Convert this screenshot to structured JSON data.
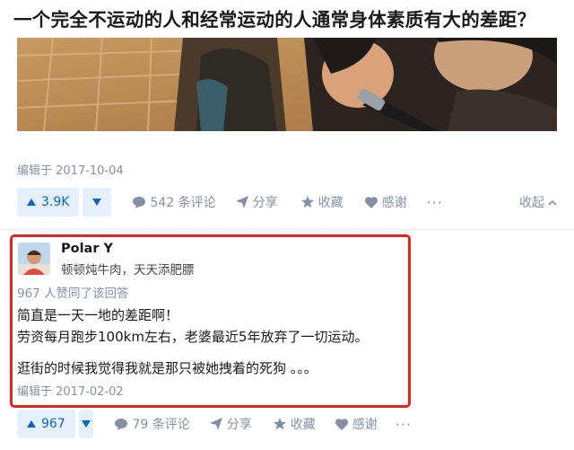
{
  "question": {
    "title": "一个完全不运动的人和经常运动的人通常身体素质有大的差距？"
  },
  "first_answer": {
    "edited": "编辑于 2017-10-04",
    "upvote_count": "3.9K",
    "comments": "542 条评论",
    "share": "分享",
    "favorite": "收藏",
    "thanks": "感谢",
    "more": "···",
    "collapse": "收起"
  },
  "second_answer": {
    "author": {
      "name": "Polar Y",
      "bio": "顿顿炖牛肉，天天添肥膘"
    },
    "approval": "967 人赞同了该回答",
    "content": [
      "简直是一天一地的差距啊！",
      "劳资每月跑步100km左右，老婆最近5年放弃了一切运动。",
      "逛街的时候我觉得我就是那只被她拽着的死狗 。。。"
    ],
    "edited": "编辑于 2017-02-02",
    "upvote_count": "967",
    "comments": "79 条评论",
    "share": "分享",
    "favorite": "收藏",
    "thanks": "感谢",
    "more": "···"
  },
  "colors": {
    "accent": "#0a66c2",
    "accent_bg": "#e6f0fd",
    "muted": "#8590a6",
    "highlight_border": "#e0271f"
  },
  "icons": [
    "triangle-up-icon",
    "triangle-down-icon",
    "comment-icon",
    "share-plane-icon",
    "star-icon",
    "heart-icon",
    "more-dots-icon",
    "chevron-up-icon"
  ]
}
